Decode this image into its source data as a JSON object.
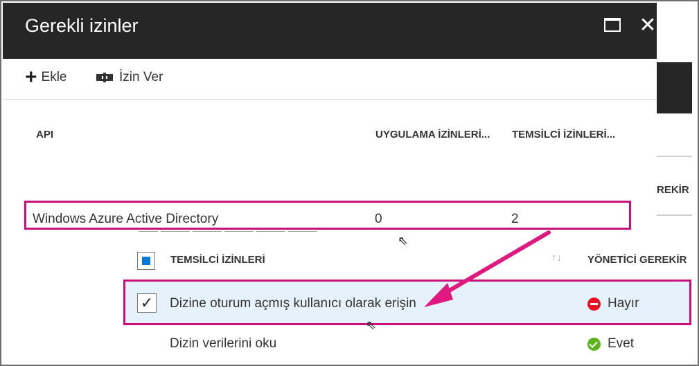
{
  "window": {
    "title": "Gerekli izinler",
    "maximize_icon": "maximize-icon",
    "close_icon": "close-icon",
    "close_glyph": "✕"
  },
  "toolbar": {
    "add_label": "Ekle",
    "grant_label": "İzin Ver"
  },
  "table": {
    "columns": [
      "API",
      "UYGULAMA İZİNLERİ...",
      "TEMSİLCİ İZİNLERİ..."
    ],
    "rows": [
      {
        "api": "Windows Azure Active Directory",
        "app_permissions": "0",
        "delegated_permissions": "2"
      }
    ]
  },
  "background_blade": {
    "partial_header": "REKİR"
  },
  "delegated": {
    "columns": [
      "TEMSİLCİ İZİNLERİ",
      "YÖNETİCİ GEREKİR"
    ],
    "items": [
      {
        "label": "Dizine oturum açmış kullanıcı olarak erişin",
        "admin_required": "Hayır",
        "checked": true
      },
      {
        "label": "Dizin verilerini oku",
        "admin_required": "Evet",
        "checked": false
      }
    ]
  },
  "colors": {
    "header_bg": "#262626",
    "highlight_border": "#c8107d",
    "selected_row_bg": "#e6f2fb",
    "no_status": "#e81123",
    "yes_status": "#5bb418",
    "accent": "#0078d7"
  }
}
